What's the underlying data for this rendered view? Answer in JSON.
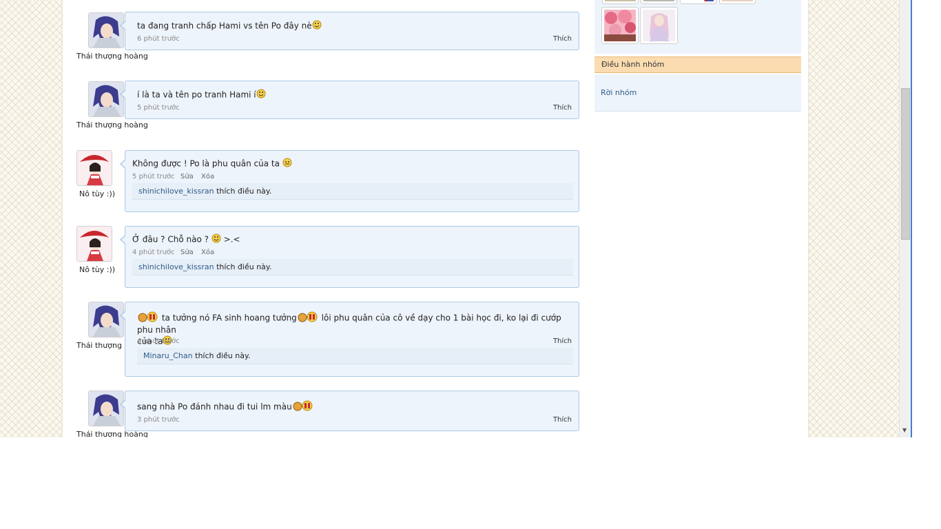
{
  "comments": [
    {
      "author": "Thái thượng hoàng",
      "text": "ta đang tranh chấp Hami vs tên Po đây nè",
      "time": "6 phút trước",
      "like": "Thích"
    },
    {
      "author": "Thái thượng hoàng",
      "text": "í là ta và tên po tranh Hami í",
      "time": "5 phút trước",
      "like": "Thích"
    },
    {
      "author": "Nô tùy :))",
      "text": "Không được ! Po là phu quân của ta",
      "time": "5 phút trước",
      "edit": "Sửa",
      "delete": "Xóa",
      "liker": "shinichilove_kissran",
      "likes_suffix": "thích điều này."
    },
    {
      "author": "Nô tùy :))",
      "text": "Ở đâu ? Chỗ nào ?",
      "text_tail": ">.<",
      "time": "4 phút trước",
      "edit": "Sửa",
      "delete": "Xóa",
      "liker": "shinichilove_kissran",
      "likes_suffix": "thích điều này."
    },
    {
      "author": "Thái thượng hoàng",
      "text_a": "ta tưởng nó FA sinh hoang tưởng",
      "text_b": "lôi phu quân của cô về dạy cho 1 bài học đi, ko lại đi cướp phu nhân",
      "text_c": "của ta",
      "time": "4 phút trước",
      "like": "Thích",
      "liker": "Minaru_Chan",
      "likes_suffix": "thích điều này."
    },
    {
      "author": "Thái thượng hoàng",
      "text": "sang nhà Po đánh nhau đi tui lm màu",
      "time": "3 phút trước",
      "like": "Thích"
    }
  ],
  "sidebar": {
    "moderation_header": "Điều hành nhóm",
    "leave_group": "Rời nhóm"
  },
  "colors": {
    "bubble_bg": "#eef4fb",
    "bubble_border": "#a9c8e6",
    "link": "#2e5b8a",
    "moderation_bg": "#fbdcb1"
  }
}
